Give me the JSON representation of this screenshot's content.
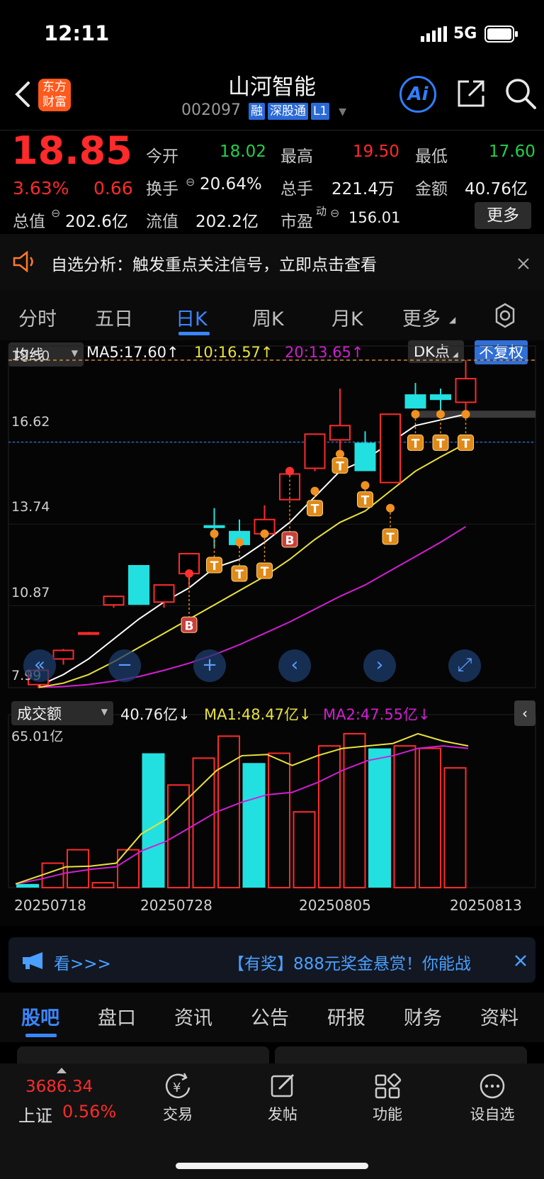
{
  "status_bar": {
    "time": "12:11",
    "network": "5G"
  },
  "header": {
    "back_icon": "chevron-left-icon",
    "brand_logo": "东方财富",
    "title": "山河智能",
    "code": "002097",
    "tags": [
      "融",
      "深股通",
      "L1"
    ],
    "ai_label": "Ai",
    "share_icon": "share-icon",
    "search_icon": "search-icon"
  },
  "quote": {
    "price": "18.85",
    "change_pct": "3.63%",
    "change_amt": "0.66",
    "open_label": "今开",
    "open": "18.02",
    "high_label": "最高",
    "high": "19.50",
    "low_label": "最低",
    "low": "17.60",
    "turnover_label": "换手",
    "turnover": "20.64%",
    "volume_label": "总手",
    "volume": "221.4万",
    "amount_label": "金额",
    "amount": "40.76亿",
    "mcap_label": "总值",
    "mcap": "202.6亿",
    "float_label": "流值",
    "float_cap": "202.2亿",
    "pe_label": "市盈",
    "pe_sup": "动",
    "pe": "156.01",
    "more_label": "更多"
  },
  "notice": {
    "text": "自选分析：触发重点关注信号，立即点击查看"
  },
  "tabs": [
    "分时",
    "五日",
    "日K",
    "周K",
    "月K",
    "更多"
  ],
  "active_tab": "日K",
  "chart_toolbar": {
    "indicator": "均线",
    "ma5": "MA5:17.60↑",
    "ma10": "10:16.57↑",
    "ma20": "20:13.65↑",
    "dk_label": "DK点",
    "adjust_label": "不复权"
  },
  "price_axis": [
    "19.50",
    "16.62",
    "13.74",
    "10.87",
    "7.99"
  ],
  "volume_toolbar": {
    "indicator": "成交额",
    "value": "40.76亿↓",
    "ma1": "MA1:48.47亿↓",
    "ma2": "MA2:47.55亿↓"
  },
  "volume_axis_max": "65.01亿",
  "date_labels": [
    "20250718",
    "20250728",
    "20250805",
    "20250813"
  ],
  "colors": {
    "up": "#ff2a2a",
    "down": "#22e0e0",
    "ma5": "#ffffff",
    "ma10": "#e8e23a",
    "ma20": "#d21ed2",
    "accent": "#2f7fff"
  },
  "chart_data": {
    "type": "candlestick",
    "ylim": [
      7.99,
      19.5
    ],
    "candles": [
      {
        "o": 8.1,
        "c": 8.6,
        "h": 8.7,
        "l": 7.99,
        "dir": "up"
      },
      {
        "o": 9.0,
        "c": 9.3,
        "h": 9.35,
        "l": 8.8,
        "dir": "up"
      },
      {
        "o": 9.92,
        "c": 9.92,
        "h": 9.95,
        "l": 9.88,
        "dir": "flat"
      },
      {
        "o": 10.9,
        "c": 11.2,
        "h": 11.2,
        "l": 10.8,
        "dir": "up"
      },
      {
        "o": 12.3,
        "c": 10.9,
        "h": 12.3,
        "l": 10.9,
        "dir": "down"
      },
      {
        "o": 11.0,
        "c": 11.6,
        "h": 11.6,
        "l": 10.8,
        "dir": "up"
      },
      {
        "o": 12.0,
        "c": 12.7,
        "h": 12.7,
        "l": 11.5,
        "dir": "up"
      },
      {
        "o": 13.7,
        "c": 13.6,
        "h": 14.3,
        "l": 12.9,
        "dir": "down"
      },
      {
        "o": 13.5,
        "c": 13.0,
        "h": 13.9,
        "l": 12.9,
        "dir": "down"
      },
      {
        "o": 13.4,
        "c": 13.9,
        "h": 14.4,
        "l": 13.4,
        "dir": "up"
      },
      {
        "o": 14.6,
        "c": 15.5,
        "h": 15.6,
        "l": 14.6,
        "dir": "up"
      },
      {
        "o": 15.7,
        "c": 16.9,
        "h": 16.9,
        "l": 15.6,
        "dir": "up"
      },
      {
        "o": 16.7,
        "c": 17.2,
        "h": 18.5,
        "l": 16.0,
        "dir": "up"
      },
      {
        "o": 16.6,
        "c": 15.6,
        "h": 17.0,
        "l": 15.6,
        "dir": "down"
      },
      {
        "o": 15.2,
        "c": 17.6,
        "h": 17.6,
        "l": 15.2,
        "dir": "up"
      },
      {
        "o": 18.3,
        "c": 17.8,
        "h": 18.7,
        "l": 17.8,
        "dir": "down"
      },
      {
        "o": 18.3,
        "c": 18.1,
        "h": 18.5,
        "l": 17.7,
        "dir": "down"
      },
      {
        "o": 18.02,
        "c": 18.85,
        "h": 19.5,
        "l": 17.6,
        "dir": "up"
      }
    ],
    "ma5": [
      8.05,
      8.45,
      9.0,
      9.7,
      10.4,
      11.0,
      11.5,
      12.2,
      12.5,
      13.1,
      13.8,
      14.7,
      15.6,
      16.0,
      16.6,
      17.2,
      17.4,
      17.6
    ],
    "ma10": [
      8.0,
      8.15,
      8.45,
      8.9,
      9.4,
      9.9,
      10.4,
      10.9,
      11.4,
      11.9,
      12.5,
      13.2,
      13.8,
      14.2,
      14.9,
      15.6,
      16.1,
      16.57
    ],
    "ma20": [
      8.0,
      8.03,
      8.1,
      8.22,
      8.38,
      8.6,
      8.85,
      9.15,
      9.5,
      9.9,
      10.3,
      10.75,
      11.2,
      11.6,
      12.1,
      12.6,
      13.1,
      13.65
    ],
    "volume": {
      "ylim": [
        0,
        65.01
      ],
      "values": [
        1.5,
        10.0,
        15.5,
        2.0,
        15.5,
        55.0,
        42.0,
        53.0,
        62.0,
        51.0,
        55.0,
        31.0,
        58.0,
        63.0,
        57.0,
        58.0,
        57.0,
        49.0
      ],
      "dir": [
        "down",
        "up",
        "up",
        "up",
        "up",
        "down",
        "up",
        "up",
        "up",
        "down",
        "up",
        "up",
        "up",
        "up",
        "down",
        "up",
        "up",
        "up"
      ],
      "ma1": [
        1.5,
        5.0,
        8.5,
        8.8,
        10.0,
        22.0,
        28.0,
        38.0,
        48.0,
        54.0,
        54.5,
        50.0,
        54.0,
        57.0,
        58.0,
        59.0,
        63.0,
        60.0,
        58.0
      ],
      "ma2": [
        1.5,
        3.5,
        6.0,
        7.5,
        8.5,
        15.0,
        19.0,
        25.0,
        31.0,
        35.0,
        38.0,
        39.0,
        43.0,
        48.0,
        52.0,
        54.0,
        57.0,
        58.0,
        57.0
      ]
    }
  },
  "nav_icons": [
    "rewind-icon",
    "zoom-out-icon",
    "zoom-in-icon",
    "chevron-left-icon",
    "chevron-right-icon",
    "fullscreen-icon"
  ],
  "ad": {
    "text": "【有奖】888元奖金悬赏！你能战",
    "trail": "看>>>"
  },
  "section_tabs": [
    "股吧",
    "盘口",
    "资讯",
    "公告",
    "研报",
    "财务",
    "资料"
  ],
  "active_section": "股吧",
  "bottom": {
    "index_value": "3686.34",
    "index_name": "上证",
    "index_change": "0.56%",
    "items": [
      {
        "label": "交易",
        "icon": "yen-cycle-icon"
      },
      {
        "label": "发帖",
        "icon": "edit-icon"
      },
      {
        "label": "功能",
        "icon": "grid-icon"
      },
      {
        "label": "设自选",
        "icon": "more-icon"
      }
    ]
  }
}
